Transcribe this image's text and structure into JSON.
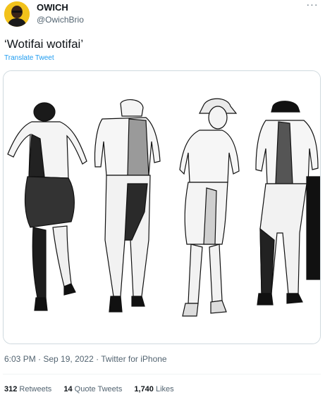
{
  "user": {
    "display_name": "OWICH",
    "handle": "@OwichBrio"
  },
  "tweet": {
    "text": "‘Wotifai wotifai’",
    "translate_label": "Translate Tweet",
    "more_label": "···"
  },
  "meta": {
    "time": "6:03 PM",
    "sep1": " · ",
    "date": "Sep 19, 2022",
    "sep2": " · ",
    "source": "Twitter for iPhone"
  },
  "stats": {
    "retweets_count": "312",
    "retweets_label": "Retweets",
    "quotes_count": "14",
    "quotes_label": "Quote Tweets",
    "likes_count": "1,740",
    "likes_label": "Likes"
  },
  "colors": {
    "avatar_bg": "#f2c21b",
    "link": "#1d9bf0",
    "secondary_text": "#536471"
  }
}
